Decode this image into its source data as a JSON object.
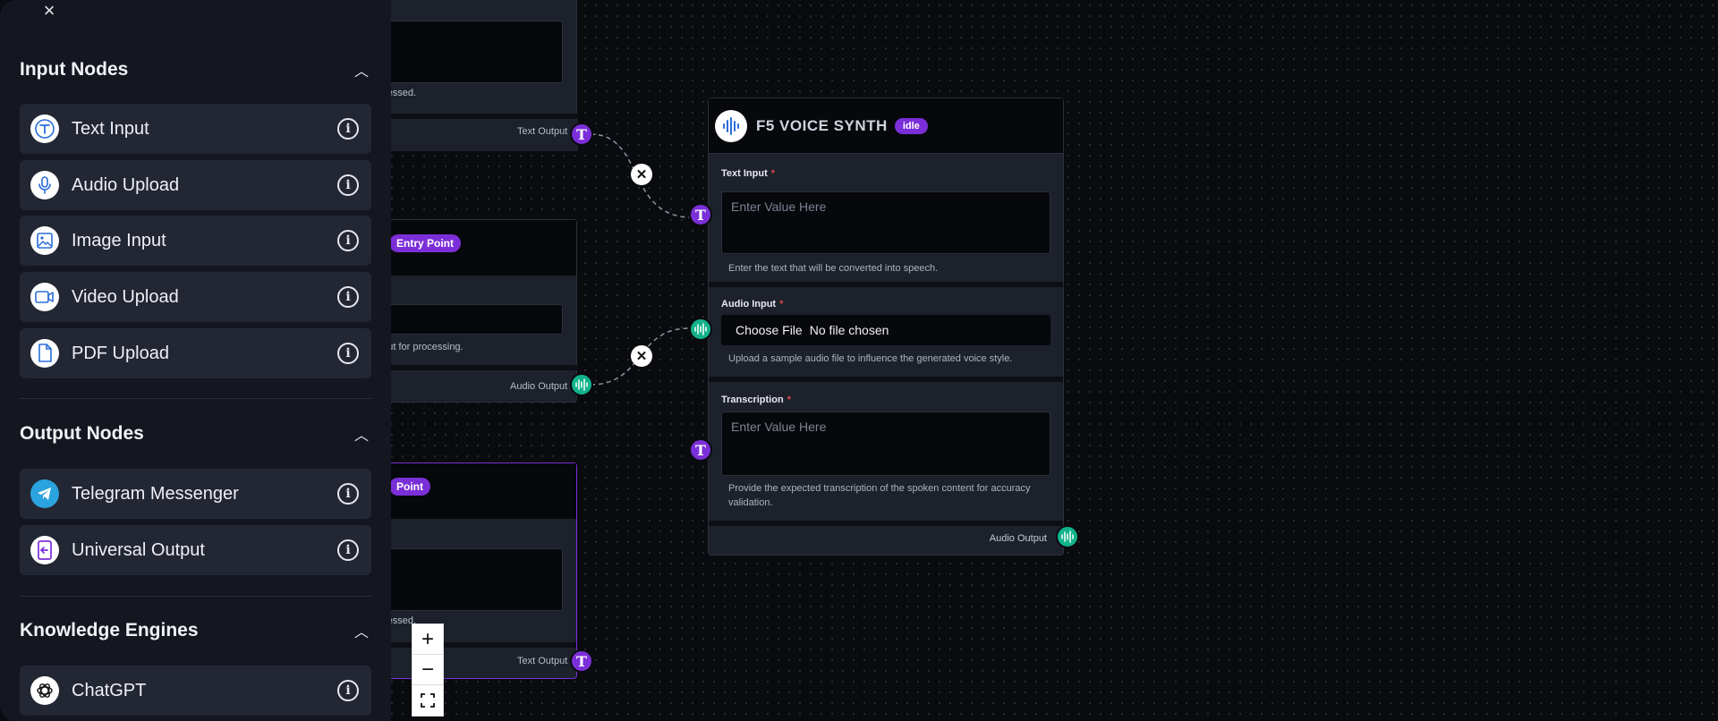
{
  "sidebar": {
    "close_label": "×",
    "sections": [
      {
        "title": "Input Nodes",
        "items": [
          {
            "label": "Text Input",
            "icon": "text-icon"
          },
          {
            "label": "Audio Upload",
            "icon": "microphone-icon"
          },
          {
            "label": "Image Input",
            "icon": "image-icon"
          },
          {
            "label": "Video Upload",
            "icon": "video-icon"
          },
          {
            "label": "PDF Upload",
            "icon": "document-icon"
          }
        ]
      },
      {
        "title": "Output Nodes",
        "items": [
          {
            "label": "Telegram Messenger",
            "icon": "telegram-icon"
          },
          {
            "label": "Universal Output",
            "icon": "output-icon"
          }
        ]
      },
      {
        "title": "Knowledge Engines",
        "items": [
          {
            "label": "ChatGPT",
            "icon": "openai-icon"
          }
        ]
      }
    ]
  },
  "canvas": {
    "partial_nodes": {
      "top": {
        "help": "ocessed.",
        "output": "Text Output"
      },
      "middle": {
        "badge": "Entry Point",
        "help": "nput for processing.",
        "output": "Audio Output"
      },
      "bottom": {
        "badge": "Point",
        "help": "ocessed.",
        "output": "Text Output"
      }
    },
    "main_node": {
      "title": "F5 VOICE SYNTH",
      "status": "idle",
      "fields": {
        "text_input": {
          "label": "Text Input",
          "required": "*",
          "placeholder": "Enter Value Here",
          "help": "Enter the text that will be converted into speech."
        },
        "audio_input": {
          "label": "Audio Input",
          "required": "*",
          "file_button": "Choose File",
          "file_status": "No file chosen",
          "help": "Upload a sample audio file to influence the generated voice style."
        },
        "transcription": {
          "label": "Transcription",
          "required": "*",
          "placeholder": "Enter Value Here",
          "help": "Provide the expected transcription of the spoken content for accuracy validation."
        }
      },
      "output": "Audio Output"
    },
    "zoom": {
      "in": "+",
      "out": "−"
    }
  },
  "colors": {
    "accent": "#7b2fd8",
    "audio": "#12b38a",
    "sidebar_bg": "#141720",
    "item_bg": "#232733"
  }
}
